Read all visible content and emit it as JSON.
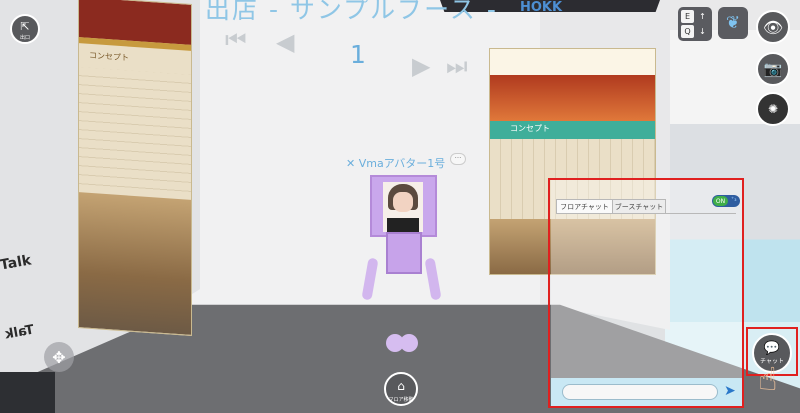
{
  "header": {
    "booth_title": "出店 - サンプルブース -",
    "booth_number": "1",
    "sign_text": "HOKK",
    "nav": {
      "first": "⏮",
      "prev": "◀",
      "next": "▶",
      "last": "⏭"
    }
  },
  "scene": {
    "signs": [
      "Talk",
      "Talk"
    ],
    "left_poster_label": "コンセプト",
    "right_poster_label": "コンセプト"
  },
  "avatar": {
    "name": "Vmaアバター1号"
  },
  "controls": {
    "exit_label": "出口",
    "floor_move_label": "フロア移動",
    "keys": [
      "E",
      "↑",
      "Q",
      "↓"
    ]
  },
  "chat": {
    "tabs": [
      {
        "label": "フロアチャット",
        "active": true
      },
      {
        "label": "ブースチャット",
        "active": false
      }
    ],
    "toggle_label": "ON",
    "input_value": "",
    "chat_button_label": "チャット"
  },
  "colors": {
    "highlight": "#e0201f",
    "title": "#8fc6e6",
    "avatar": "#c9a7ec"
  }
}
